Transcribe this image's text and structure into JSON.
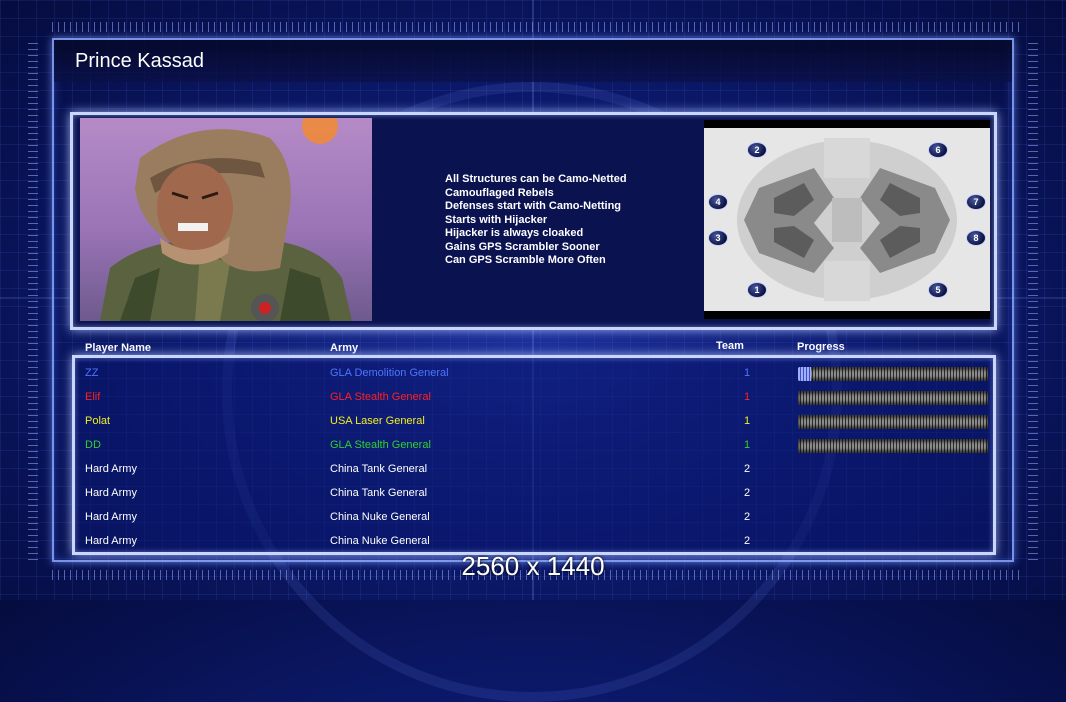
{
  "header": {
    "title": "Prince Kassad"
  },
  "general": {
    "abilities": [
      "All Structures can be Camo-Netted",
      "Camouflaged Rebels",
      "Defenses start with Camo-Netting",
      "Starts with Hijacker",
      "Hijacker is always cloaked",
      "Gains GPS Scrambler Sooner",
      "Can GPS Scramble More Often"
    ]
  },
  "minimap": {
    "slots": [
      "1",
      "2",
      "3",
      "4",
      "5",
      "6",
      "7",
      "8"
    ]
  },
  "table": {
    "headers": {
      "player": "Player Name",
      "army": "Army",
      "team": "Team",
      "progress": "Progress"
    },
    "rows": [
      {
        "player": "ZZ",
        "army": "GLA Demolition General",
        "team": "1",
        "color": "#4f74ff",
        "progress": 0.07
      },
      {
        "player": "Elif",
        "army": "GLA Stealth General",
        "team": "1",
        "color": "#ff2020",
        "progress": 0
      },
      {
        "player": "Polat",
        "army": "USA Laser General",
        "team": "1",
        "color": "#f0f020",
        "progress": 0
      },
      {
        "player": "DD",
        "army": "GLA Stealth General",
        "team": "1",
        "color": "#30d030",
        "progress": 0
      },
      {
        "player": "Hard Army",
        "army": "China Tank General",
        "team": "2",
        "color": "#ffffff"
      },
      {
        "player": "Hard Army",
        "army": "China Tank General",
        "team": "2",
        "color": "#ffffff"
      },
      {
        "player": "Hard Army",
        "army": "China Nuke General",
        "team": "2",
        "color": "#ffffff"
      },
      {
        "player": "Hard Army",
        "army": "China Nuke General",
        "team": "2",
        "color": "#ffffff"
      }
    ]
  },
  "footer": {
    "resolution": "2560 x 1440"
  }
}
